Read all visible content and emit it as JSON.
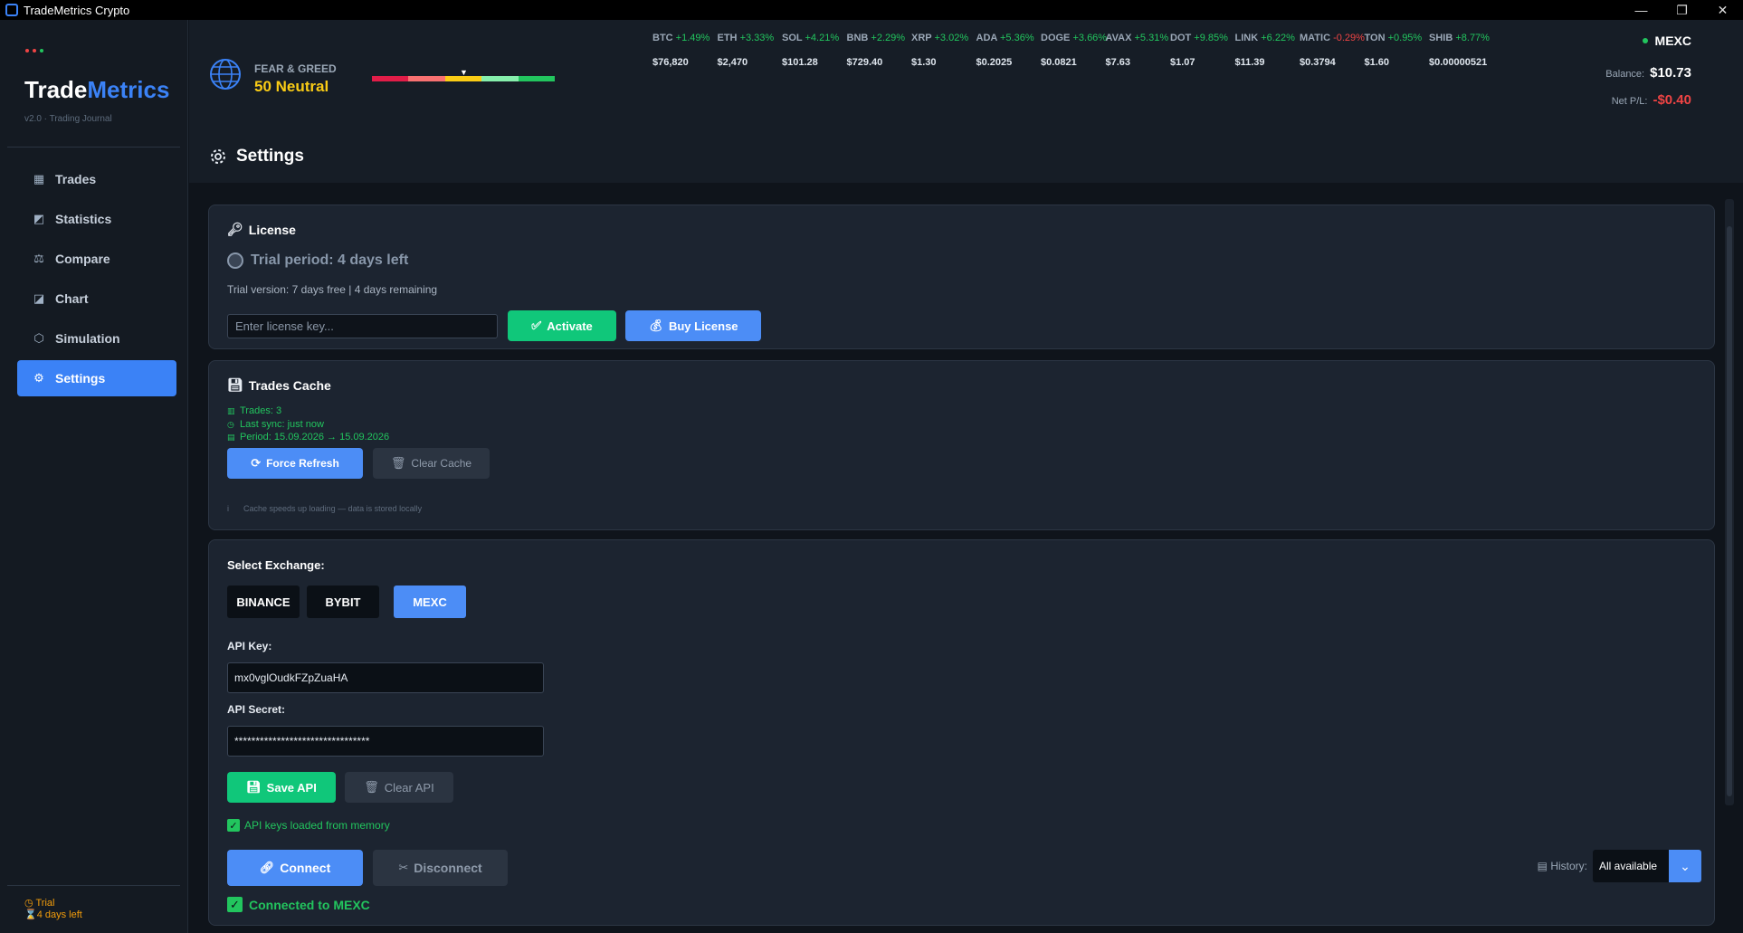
{
  "window": {
    "title": "TradeMetrics Crypto",
    "controls": [
      "—",
      "❐",
      "✕"
    ]
  },
  "sidebar": {
    "brand_part1": "Trade",
    "brand_part2": "Metrics",
    "version": "v2.0 · Trading Journal",
    "dots": [
      "#ef4444",
      "#ef4444",
      "#22c55e"
    ],
    "items": [
      {
        "label": "Trades",
        "icon": "bar-chart-icon",
        "glyph": "▦"
      },
      {
        "label": "Statistics",
        "icon": "line-chart-icon",
        "glyph": "◩"
      },
      {
        "label": "Compare",
        "icon": "compare-icon",
        "glyph": "⚖"
      },
      {
        "label": "Chart",
        "icon": "chart-icon",
        "glyph": "◪"
      },
      {
        "label": "Simulation",
        "icon": "cube-icon",
        "glyph": "⬡"
      },
      {
        "label": "Settings",
        "icon": "gear-icon",
        "glyph": "⚙",
        "active": true
      }
    ],
    "trial_status": "Trial",
    "trial_days": "4 days left"
  },
  "topbar": {
    "fear_greed_label": "FEAR & GREED",
    "fear_greed_value": "50 Neutral",
    "fear_greed_colors": [
      "#e11d48",
      "#f87171",
      "#facc15",
      "#86efac",
      "#22c55e"
    ],
    "ticker": [
      {
        "sym": "BTC",
        "chg": "+1.49%",
        "price": "$76,820",
        "up": true
      },
      {
        "sym": "ETH",
        "chg": "+3.33%",
        "price": "$2,470",
        "up": true
      },
      {
        "sym": "SOL",
        "chg": "+4.21%",
        "price": "$101.28",
        "up": true
      },
      {
        "sym": "BNB",
        "chg": "+2.29%",
        "price": "$729.40",
        "up": true
      },
      {
        "sym": "XRP",
        "chg": "+3.02%",
        "price": "$1.30",
        "up": true
      },
      {
        "sym": "ADA",
        "chg": "+5.36%",
        "price": "$0.2025",
        "up": true
      },
      {
        "sym": "DOGE",
        "chg": "+3.66%",
        "price": "$0.0821",
        "up": true
      },
      {
        "sym": "AVAX",
        "chg": "+5.31%",
        "price": "$7.63",
        "up": true
      },
      {
        "sym": "DOT",
        "chg": "+9.85%",
        "price": "$1.07",
        "up": true
      },
      {
        "sym": "LINK",
        "chg": "+6.22%",
        "price": "$11.39",
        "up": true
      },
      {
        "sym": "MATIC",
        "chg": "-0.29%",
        "price": "$0.3794",
        "up": false
      },
      {
        "sym": "TON",
        "chg": "+0.95%",
        "price": "$1.60",
        "up": true
      },
      {
        "sym": "SHIB",
        "chg": "+8.77%",
        "price": "$0.00000521",
        "up": true
      }
    ],
    "exchange": "MEXC",
    "balance_label": "Balance:",
    "balance_value": "$10.73",
    "netpl_label": "Net P/L:",
    "netpl_value": "-$0.40",
    "page_title": "Settings"
  },
  "license": {
    "title": "License",
    "trial_period": "Trial period: 4 days left",
    "trial_sub": "Trial version: 7 days free | 4 days remaining",
    "input_placeholder": "Enter license key...",
    "activate": "Activate",
    "buy": "Buy License"
  },
  "cache": {
    "title": "Trades Cache",
    "trades": "Trades: 3",
    "last_sync": "Last sync: just now",
    "period": "Period: 15.09.2026 → 15.09.2026",
    "force_refresh": "Force Refresh",
    "clear_cache": "Clear Cache",
    "note_icon": "i",
    "note": "Cache speeds up loading — data is stored locally"
  },
  "api": {
    "select_label": "Select Exchange:",
    "exchanges": [
      "BINANCE",
      "BYBIT",
      "MEXC"
    ],
    "selected_exchange": "MEXC",
    "key_label": "API Key:",
    "key_value": "mx0vglOudkFZpZuaHA",
    "secret_label": "API Secret:",
    "secret_value": "********************************",
    "save": "Save API",
    "clear": "Clear API",
    "loaded_msg": "API keys loaded from memory",
    "connect": "Connect",
    "disconnect": "Disconnect",
    "history_label": "History:",
    "history_value": "All available",
    "connected_msg": "Connected to MEXC"
  }
}
